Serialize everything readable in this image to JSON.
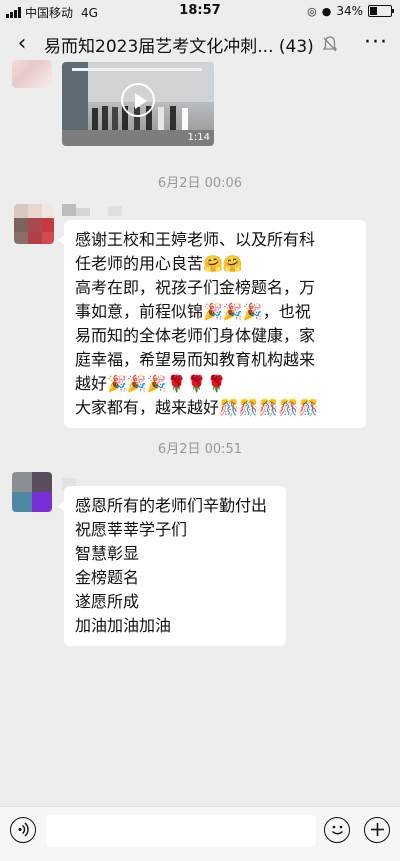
{
  "status_bar": {
    "carrier": "中国移动",
    "network": "4G",
    "time": "18:57",
    "battery_percent": "34%",
    "battery_level": 0.34
  },
  "nav": {
    "back_icon": "‹",
    "title": "易而知2023届艺考文化冲刺... (43)",
    "more_icon": "···"
  },
  "messages": [
    {
      "type": "video",
      "duration": "1:14"
    },
    {
      "type": "timestamp",
      "text": "6月2日 00:06"
    },
    {
      "type": "text",
      "lines": [
        "感谢王校和王婷老师、以及所有科",
        "任老师的用心良苦🤗🤗",
        "高考在即，祝孩子们金榜题名，万",
        "事如意，前程似锦🎉🎉🎉，也祝",
        "易而知的全体老师们身体健康，家",
        "庭幸福，希望易而知教育机构越来",
        "越好🎉🎉🎉🌹🌹🌹",
        "大家都有，越来越好🎊🎊🎊🎊🎊"
      ]
    },
    {
      "type": "timestamp",
      "text": "6月2日 00:51"
    },
    {
      "type": "text",
      "lines": [
        "感恩所有的老师们辛勤付出",
        "祝愿莘莘学子们",
        "智慧彰显",
        "金榜题名",
        "遂愿所成",
        "加油加油加油"
      ]
    }
  ],
  "input_bar": {
    "voice_icon": "voice-icon",
    "emoji_icon": "emoji-icon",
    "plus_icon": "plus-icon"
  }
}
